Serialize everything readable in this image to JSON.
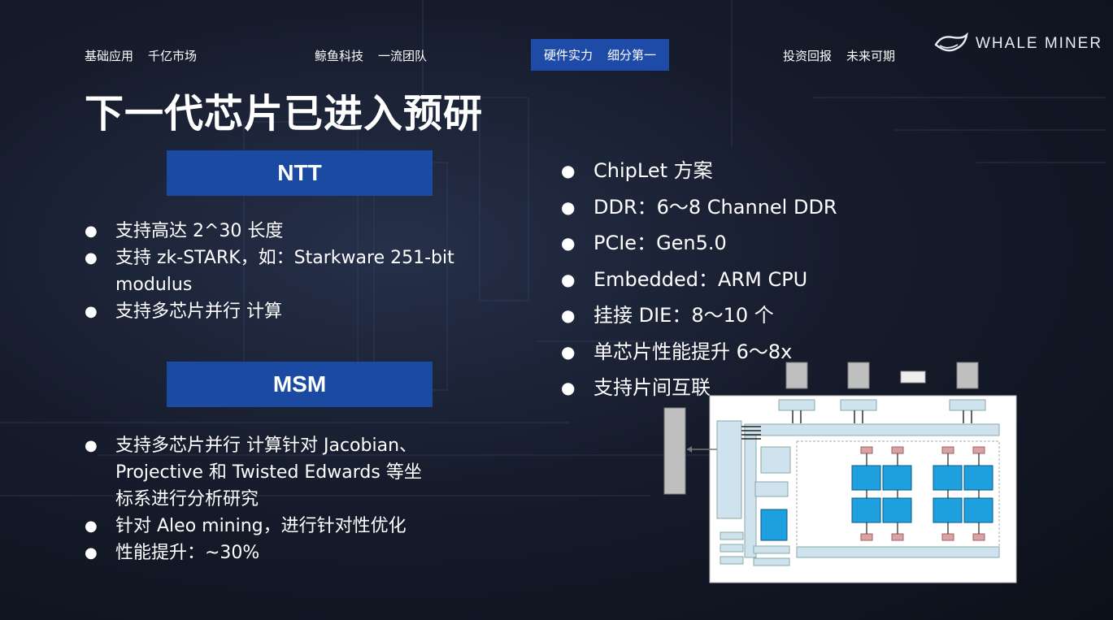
{
  "nav": [
    {
      "part1": "基础应用",
      "part2": "千亿市场"
    },
    {
      "part1": "鲸鱼科技",
      "part2": "一流团队"
    },
    {
      "part1": "硬件实力",
      "part2": "细分第一"
    },
    {
      "part1": "投资回报",
      "part2": "未来可期"
    }
  ],
  "logo": {
    "text": "WHALE MINER"
  },
  "title": "下一代芯片已进入预研",
  "ntt": {
    "heading": "NTT",
    "items": [
      "支持高达 2^30 长度",
      "支持 zk-STARK，如：Starkware 251-bit modulus",
      "支持多芯片并行 计算"
    ]
  },
  "msm": {
    "heading": "MSM",
    "items": [
      "支持多芯片并行 计算针对 Jacobian、Projective 和 Twisted Edwards 等坐标系进行分析研究",
      "针对 Aleo mining，进行针对性优化",
      "性能提升：~30%"
    ]
  },
  "specs": {
    "items": [
      "ChipLet 方案",
      "DDR：6～8 Channel DDR",
      "PCIe：Gen5.0",
      "Embedded：ARM CPU",
      "挂接 DIE：8～10 个",
      "单芯片性能提升 6～8x",
      "支持片间互联"
    ]
  },
  "colors": {
    "accent": "#1b4aa3",
    "diagram_core": "#1ea0de",
    "diagram_bus": "#cfe3ef",
    "diagram_pad": "#d9a3a3"
  }
}
